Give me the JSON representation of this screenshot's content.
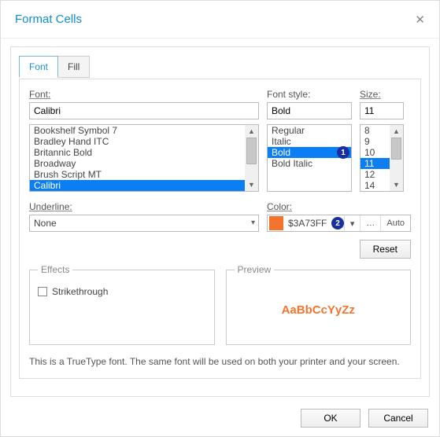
{
  "title": "Format Cells",
  "tabs": {
    "font": "Font",
    "fill": "Fill"
  },
  "labels": {
    "font": "Font:",
    "style": "Font style:",
    "size": "Size:",
    "underline": "Underline:",
    "color": "Color:",
    "effects": "Effects",
    "preview": "Preview",
    "strikethrough": "Strikethrough"
  },
  "values": {
    "font": "Calibri",
    "style": "Bold",
    "size": "11",
    "underline": "None",
    "color_hex": "$3A73FF",
    "swatch": "#f3742f",
    "auto": "Auto",
    "preview": "AaBbCcYyZz"
  },
  "font_list": [
    "Bookshelf Symbol 7",
    "Bradley Hand ITC",
    "Britannic Bold",
    "Broadway",
    "Brush Script MT",
    "Calibri"
  ],
  "style_list": [
    "Regular",
    "Italic",
    "Bold",
    "Bold Italic"
  ],
  "size_list": [
    "8",
    "9",
    "10",
    "11",
    "12",
    "14"
  ],
  "buttons": {
    "reset": "Reset",
    "ok": "OK",
    "cancel": "Cancel"
  },
  "markers": {
    "m1": "1",
    "m2": "2"
  },
  "footnote": "This is a TrueType font. The same font will be used on both your printer and your screen."
}
